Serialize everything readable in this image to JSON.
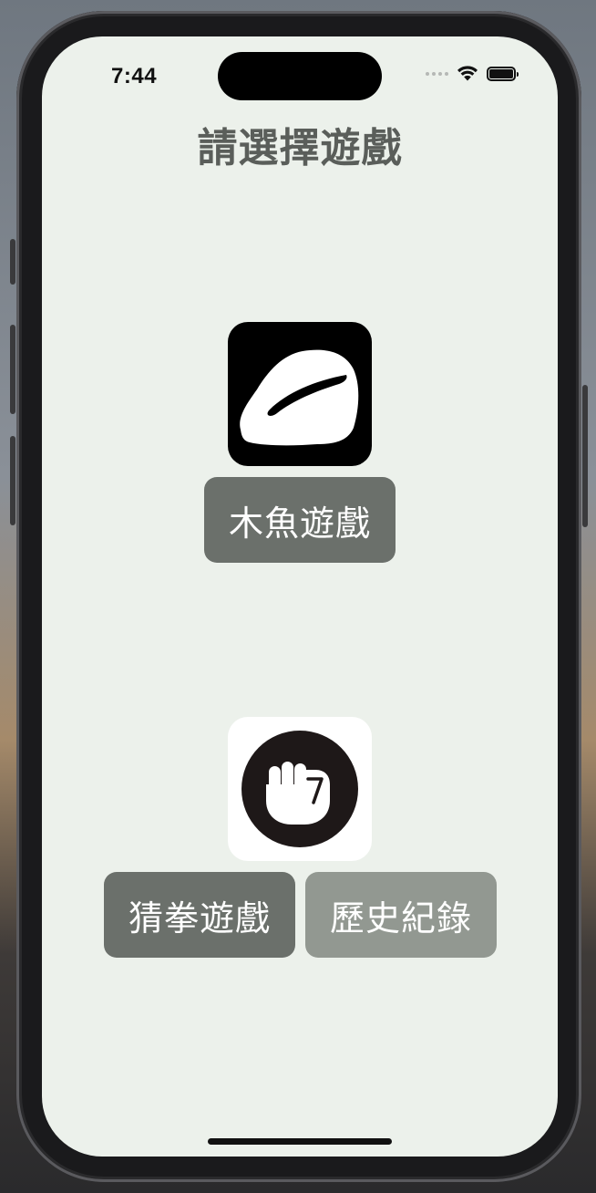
{
  "status_bar": {
    "time": "7:44"
  },
  "page": {
    "title": "請選擇遊戲"
  },
  "games": {
    "muyu": {
      "button_label": "木魚遊戲",
      "icon": "wooden-fish-icon"
    },
    "rps": {
      "button_label": "猜拳遊戲",
      "icon": "fist-icon"
    }
  },
  "history": {
    "button_label": "歷史紀錄"
  },
  "colors": {
    "background": "#ecf1eb",
    "title": "#5a5e5a",
    "button_primary": "#6b706b",
    "button_secondary": "#929891",
    "button_text": "#ffffff"
  }
}
